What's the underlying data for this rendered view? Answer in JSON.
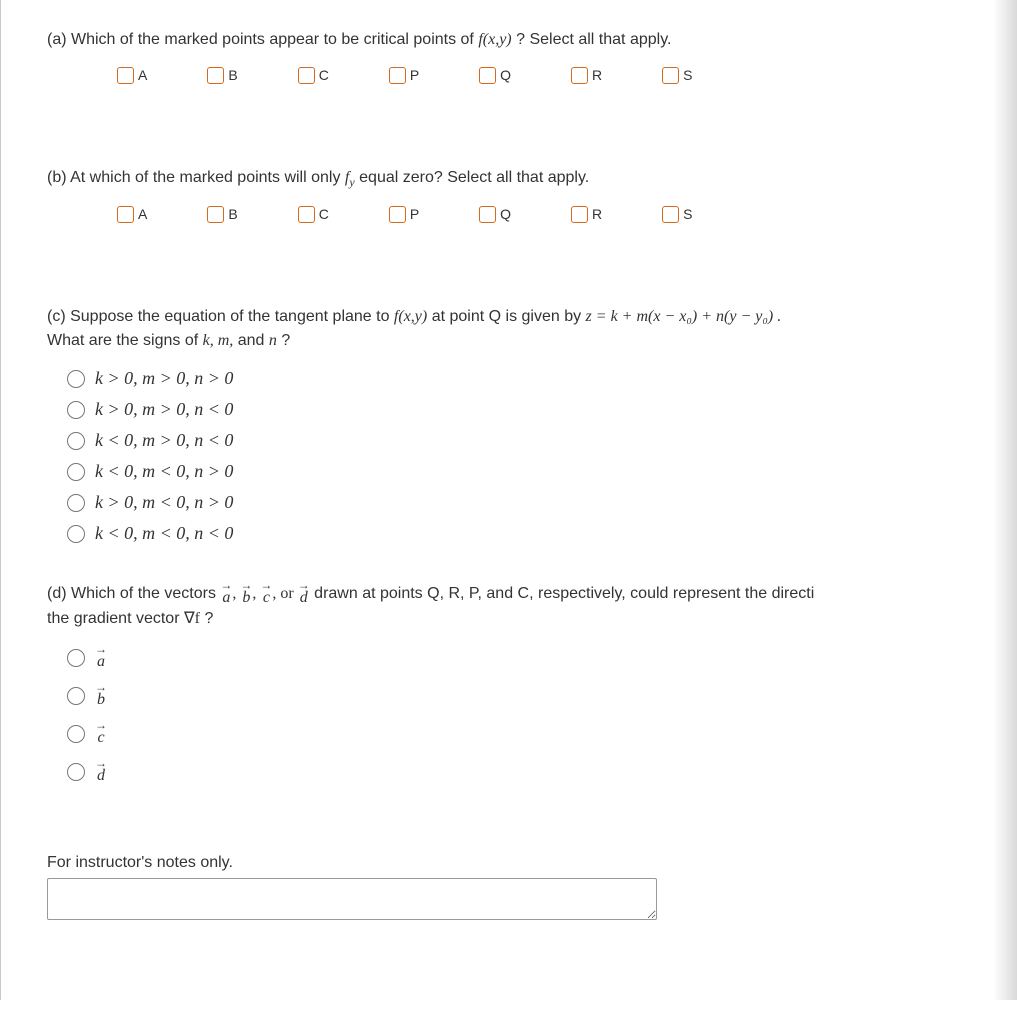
{
  "qa": {
    "prompt_pre": "(a) Which of the marked points appear to be critical points of ",
    "func": "f(x,y)",
    "prompt_post": " ? Select all that apply.",
    "options": [
      "A",
      "B",
      "C",
      "P",
      "Q",
      "R",
      "S"
    ]
  },
  "qb": {
    "prompt_pre": "(b) At which of the marked points will only ",
    "fy": "f",
    "fy_sub": "y",
    "prompt_post": " equal zero? Select all that apply.",
    "options": [
      "A",
      "B",
      "C",
      "P",
      "Q",
      "R",
      "S"
    ]
  },
  "qc": {
    "line1_pre": "(c) Suppose the equation of the tangent plane to ",
    "func": "f(x,y)",
    "line1_mid": " at point Q is given by ",
    "eqn": "z = k + m(x − x₀) + n(y − y₀) .",
    "line2": "What are the signs of ",
    "kmn": "k, m,",
    "line2_and": " and ",
    "n": "n",
    "line2_post": "?",
    "options": [
      "k > 0,  m > 0,  n > 0",
      "k > 0,  m > 0,  n < 0",
      "k < 0,  m > 0,  n < 0",
      "k < 0,  m < 0,  n > 0",
      "k > 0,  m < 0,  n > 0",
      "k < 0,  m < 0,  n < 0"
    ]
  },
  "qd": {
    "pre": "(d) Which of the vectors  ",
    "vecs": [
      "a",
      "b",
      "c",
      "d"
    ],
    "mid": "  drawn at points Q, R, P, and C, respectively, could represent the directi",
    "line2_pre": "the gradient vector ",
    "grad": "∇f",
    "line2_post": "?",
    "options": [
      "a",
      "b",
      "c",
      "d"
    ]
  },
  "notes": {
    "label": "For instructor's notes only.",
    "value": ""
  }
}
